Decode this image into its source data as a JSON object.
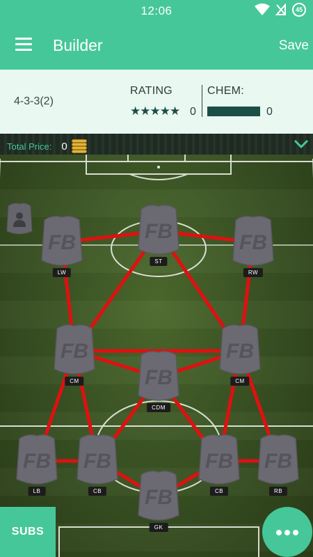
{
  "status": {
    "time": "12:06",
    "badge": "45"
  },
  "app_bar": {
    "title": "Builder",
    "save_label": "Save"
  },
  "info": {
    "formation": "4-3-3(2)",
    "rating_label": "RATING",
    "rating_stars": "★★★★★",
    "rating_value": "0",
    "chem_label": "CHEM:",
    "chem_value": "0"
  },
  "price": {
    "label": "Total Price:",
    "value": "0"
  },
  "card_logo": "FB",
  "positions": [
    {
      "id": "lw",
      "label": "LW"
    },
    {
      "id": "st",
      "label": "ST"
    },
    {
      "id": "rw",
      "label": "RW"
    },
    {
      "id": "lcm",
      "label": "CM"
    },
    {
      "id": "rcm",
      "label": "CM"
    },
    {
      "id": "cdm",
      "label": "CDM"
    },
    {
      "id": "lb",
      "label": "LB"
    },
    {
      "id": "lcb",
      "label": "CB"
    },
    {
      "id": "rcb",
      "label": "CB"
    },
    {
      "id": "rb",
      "label": "RB"
    },
    {
      "id": "gk",
      "label": "GK"
    }
  ],
  "links": [
    [
      "lw",
      "st"
    ],
    [
      "st",
      "rw"
    ],
    [
      "lw",
      "lcm"
    ],
    [
      "st",
      "lcm"
    ],
    [
      "st",
      "rcm"
    ],
    [
      "rw",
      "rcm"
    ],
    [
      "lcm",
      "cdm"
    ],
    [
      "rcm",
      "cdm"
    ],
    [
      "lcm",
      "rcm"
    ],
    [
      "lcm",
      "lb"
    ],
    [
      "lcm",
      "lcb"
    ],
    [
      "cdm",
      "lcb"
    ],
    [
      "cdm",
      "rcb"
    ],
    [
      "rcm",
      "rcb"
    ],
    [
      "rcm",
      "rb"
    ],
    [
      "lb",
      "lcb"
    ],
    [
      "lcb",
      "gk"
    ],
    [
      "gk",
      "rcb"
    ],
    [
      "rcb",
      "rb"
    ]
  ],
  "buttons": {
    "subs_label": "SUBS"
  },
  "colors": {
    "accent": "#46c79a",
    "link": "#e01010",
    "card": "#6b6a72",
    "dark_teal": "#1d4e46"
  }
}
